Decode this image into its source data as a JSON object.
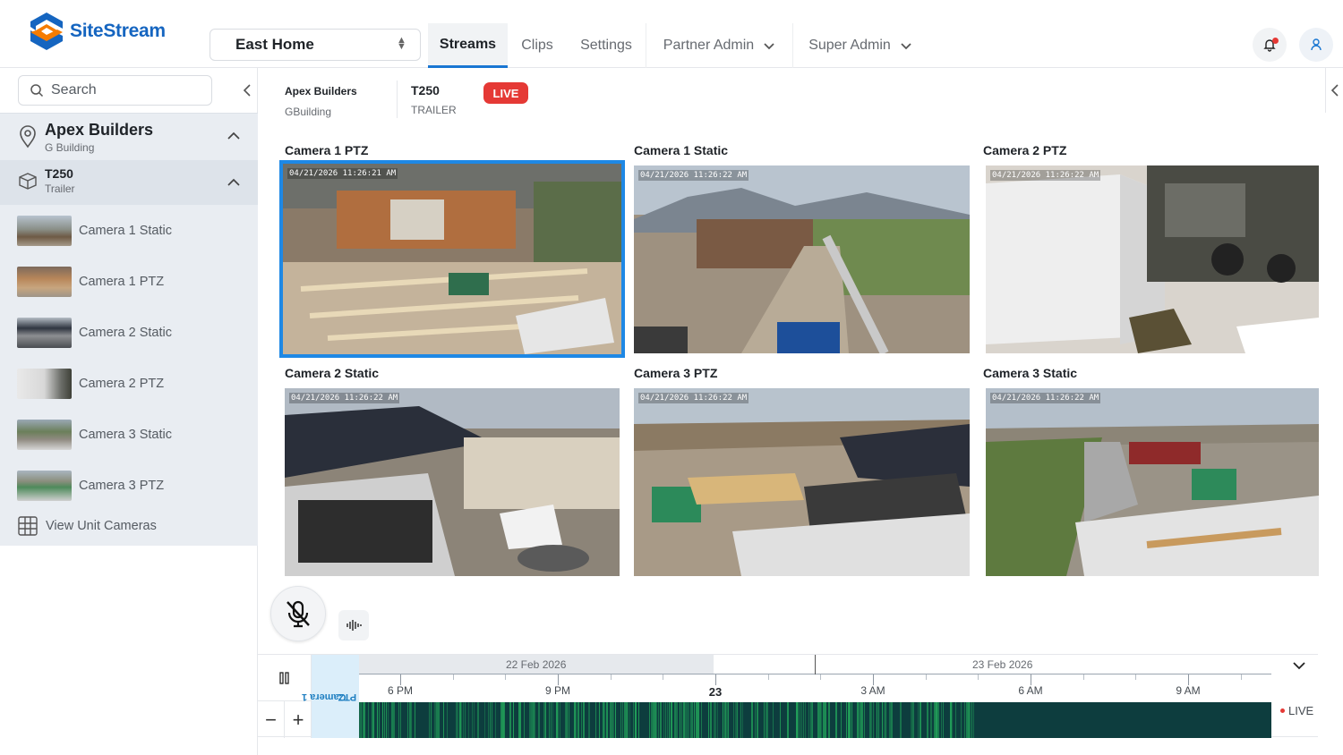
{
  "app": {
    "name": "SiteStream"
  },
  "header": {
    "site_selector": "East Home",
    "tabs": [
      "Streams",
      "Clips",
      "Settings",
      "Partner Admin",
      "Super Admin"
    ],
    "active_tab": "Streams"
  },
  "sidebar": {
    "search_placeholder": "Search",
    "site": {
      "name": "Apex Builders",
      "sub": "G Building"
    },
    "unit": {
      "name": "T250",
      "sub": "Trailer"
    },
    "cameras": [
      "Camera 1 Static",
      "Camera 1 PTZ",
      "Camera 2 Static",
      "Camera 2 PTZ",
      "Camera 3 Static",
      "Camera 3 PTZ"
    ],
    "view_unit_cameras": "View Unit Cameras"
  },
  "info": {
    "company": "Apex Builders",
    "building": "GBuilding",
    "unit": "T250",
    "unit_type": "TRAILER",
    "live_badge": "LIVE"
  },
  "grid": {
    "cameras": [
      {
        "title": "Camera 1 PTZ",
        "timestamp": "04/21/2026 11:26:21 AM",
        "selected": true
      },
      {
        "title": "Camera 1 Static",
        "timestamp": "04/21/2026 11:26:22 AM",
        "selected": false
      },
      {
        "title": "Camera 2 PTZ",
        "timestamp": "04/21/2026 11:26:22 AM",
        "selected": false
      },
      {
        "title": "Camera 2 Static",
        "timestamp": "04/21/2026 11:26:22 AM",
        "selected": false
      },
      {
        "title": "Camera 3 PTZ",
        "timestamp": "04/21/2026 11:26:22 AM",
        "selected": false
      },
      {
        "title": "Camera 3 Static",
        "timestamp": "04/21/2026 11:26:22 AM",
        "selected": false
      }
    ]
  },
  "timeline": {
    "camera_label_line1": "Camera 1",
    "camera_label_line2": "PTZ",
    "dates": [
      "22 Feb 2026",
      "23 Feb 2026"
    ],
    "hours": [
      "6 PM",
      "9 PM",
      "23",
      "3 AM",
      "6 AM",
      "9 AM"
    ],
    "live_label": "LIVE",
    "minus": "−",
    "plus": "+"
  },
  "colors": {
    "accent": "#1976d2",
    "live": "#e53935",
    "timeline_recorded": "#0d3d3e",
    "timeline_activity": "#22a35a"
  },
  "icons": {
    "logo": "sitestream-logo-icon",
    "site": "map-pin-icon",
    "unit": "trailer-box-icon",
    "grid": "grid-icon",
    "bell": "bell-icon",
    "user": "user-icon",
    "mic": "mic-off-icon",
    "wave": "audio-wave-icon"
  }
}
